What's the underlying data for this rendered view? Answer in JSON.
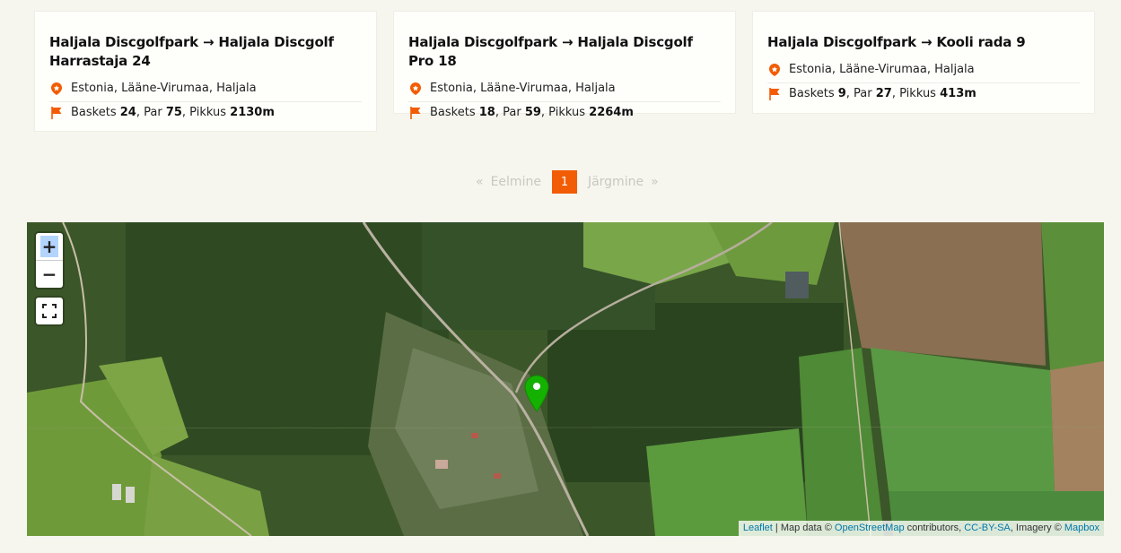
{
  "cards": [
    {
      "title": "Haljala Discgolfpark → Haljala Discgolf Harrastaja 24",
      "location": "Estonia, Lääne-Virumaa, Haljala",
      "baskets_label": "Baskets",
      "baskets": "24",
      "par_label": "Par",
      "par": "75",
      "length_label": "Pikkus",
      "length": "2130m"
    },
    {
      "title": "Haljala Discgolfpark → Haljala Discgolf Pro 18",
      "location": "Estonia, Lääne-Virumaa, Haljala",
      "baskets_label": "Baskets",
      "baskets": "18",
      "par_label": "Par",
      "par": "59",
      "length_label": "Pikkus",
      "length": "2264m"
    },
    {
      "title": "Haljala Discgolfpark → Kooli rada 9",
      "location": "Estonia, Lääne-Virumaa, Haljala",
      "baskets_label": "Baskets",
      "baskets": "9",
      "par_label": "Par",
      "par": "27",
      "length_label": "Pikkus",
      "length": "413m"
    }
  ],
  "pagination": {
    "prev_arrow": "«",
    "prev_label": "Eelmine",
    "current_page": "1",
    "next_label": "Järgmine",
    "next_arrow": "»"
  },
  "map": {
    "zoom_in": "+",
    "zoom_out": "−",
    "fullscreen_icon": "fullscreen-icon",
    "marker_color": "#15b100",
    "attribution": {
      "leaflet": "Leaflet",
      "sep": " | Map data © ",
      "osm": "OpenStreetMap",
      "contrib": " contributors, ",
      "license": "CC-BY-SA",
      "imagery": ", Imagery © ",
      "mapbox": "Mapbox"
    }
  },
  "colors": {
    "accent": "#f25c05",
    "background": "#f6f6ef"
  }
}
